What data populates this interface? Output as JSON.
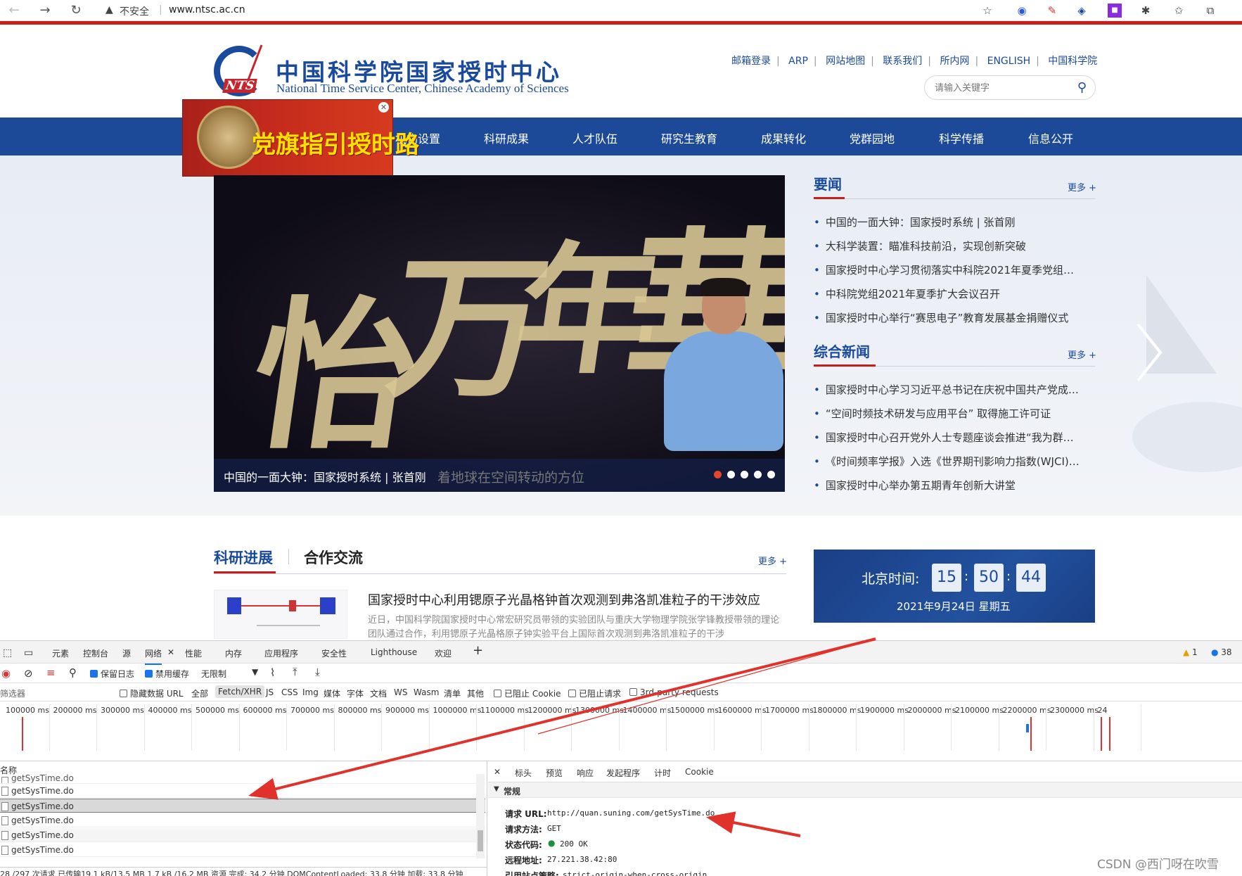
{
  "browser": {
    "security_label": "不安全",
    "url": "www.ntsc.ac.cn"
  },
  "site": {
    "logo_badge": "NTS",
    "name_cn": "中国科学院国家授时中心",
    "name_en": "National Time Service Center, Chinese Academy of Sciences",
    "top_links": [
      "邮箱登录",
      "ARP",
      "网站地图",
      "联系我们",
      "所内网",
      "ENGLISH",
      "中国科学院"
    ],
    "search_placeholder": "请输入关键字",
    "banner_text": "党旗指引授时路",
    "nav": [
      "机构设置",
      "科研成果",
      "人才队伍",
      "研究生教育",
      "成果转化",
      "党群园地",
      "科学传播",
      "信息公开"
    ]
  },
  "slider": {
    "calligraphy": [
      "怡",
      "万",
      "年",
      "華"
    ],
    "caption": "中国的一面大钟：国家授时系统 | 张首刚",
    "ghost_text": "着地球在空间转动的方位",
    "dots": 5,
    "active_dot": 0
  },
  "news": {
    "title": "要闻",
    "more": "更多 +",
    "items": [
      "中国的一面大钟：国家授时系统 | 张首刚",
      "大科学装置：瞄准科技前沿，实现创新突破",
      "国家授时中心学习贯彻落实中科院2021年夏季党组…",
      "中科院党组2021年夏季扩大会议召开",
      "国家授时中心举行“赛思电子”教育发展基金捐赠仪式"
    ]
  },
  "general": {
    "title": "综合新闻",
    "more": "更多 +",
    "items": [
      "国家授时中心学习习近平总书记在庆祝中国共产党成…",
      "“空间时频技术研发与应用平台” 取得施工许可证",
      "国家授时中心召开党外人士专题座谈会推进“我为群…",
      "《时间频率学报》入选《世界期刊影响力指数(WJCI)…",
      "国家授时中心举办第五期青年创新大讲堂"
    ]
  },
  "research": {
    "tab_active": "科研进展",
    "tab_other": "合作交流",
    "more": "更多 +",
    "headline": "国家授时中心利用锶原子光晶格钟首次观测到弗洛凯准粒子的干涉效应",
    "summary": "近日，中国科学院国家授时中心常宏研究员带领的实验团队与重庆大学物理学院张学锋教授带领的理论团队通过合作，利用锶原子光晶格原子钟实验平台上国际首次观测到弗洛凯准粒子的干涉"
  },
  "clock": {
    "label": "北京时间:",
    "hour": "15",
    "minute": "50",
    "second": "44",
    "date": "2021年9月24日 星期五"
  },
  "devtools": {
    "tabs": [
      "元素",
      "控制台",
      "源",
      "网络",
      "性能",
      "内存",
      "应用程序",
      "安全性",
      "Lighthouse",
      "欢迎"
    ],
    "active_tab": "网络",
    "warnings": "1",
    "messages": "38",
    "toolbar": {
      "preserve_log": "保留日志",
      "disable_cache": "禁用缓存",
      "throttle": "无限制"
    },
    "filter": {
      "label": "筛选器",
      "hide_data_urls": "隐藏数据 URL",
      "types": [
        "全部",
        "Fetch/XHR",
        "JS",
        "CSS",
        "Img",
        "媒体",
        "字体",
        "文档",
        "WS",
        "Wasm",
        "清单",
        "其他"
      ],
      "active_type": "Fetch/XHR",
      "blocked_cookies": "已阻止 Cookie",
      "blocked_requests": "已阻止请求",
      "third_party": "3rd-party requests"
    },
    "timeline_ticks": [
      "100000 ms",
      "200000 ms",
      "300000 ms",
      "400000 ms",
      "500000 ms",
      "600000 ms",
      "700000 ms",
      "800000 ms",
      "900000 ms",
      "1000000 ms",
      "1100000 ms",
      "1200000 ms",
      "1300000 ms",
      "1400000 ms",
      "1500000 ms",
      "1600000 ms",
      "1700000 ms",
      "1800000 ms",
      "1900000 ms",
      "2000000 ms",
      "2100000 ms",
      "2200000 ms",
      "2300000 ms",
      "24"
    ],
    "name_header": "名称",
    "files": [
      "getSysTime.do",
      "getSysTime.do",
      "getSysTime.do",
      "getSysTime.do",
      "getSysTime.do",
      "getSysTime.do"
    ],
    "status_bar": "28 /297 次请求  已传输19.1 kB/13.5 MB  1.7 kB /16.2 MB 资源  完成: 34.2 分钟  DOMContentLoaded: 33.8 分钟  加载: 33.8 分钟",
    "detail_tabs": [
      "标头",
      "预览",
      "响应",
      "发起程序",
      "计时",
      "Cookie"
    ],
    "general_section": "常规",
    "headers": [
      {
        "key": "请求 URL:",
        "value": "http://quan.suning.com/getSysTime.do"
      },
      {
        "key": "请求方法:",
        "value": "GET"
      },
      {
        "key": "状态代码:",
        "value": "200 OK"
      },
      {
        "key": "远程地址:",
        "value": "27.221.38.42:80"
      },
      {
        "key": "引用站点策略:",
        "value": "strict-origin-when-cross-origin"
      }
    ]
  },
  "watermark": "CSDN @西门呀在吹雪",
  "colors": {
    "brand_blue": "#1c4a98",
    "accent_red": "#c81d1d",
    "annotation_red": "#e0312b"
  }
}
